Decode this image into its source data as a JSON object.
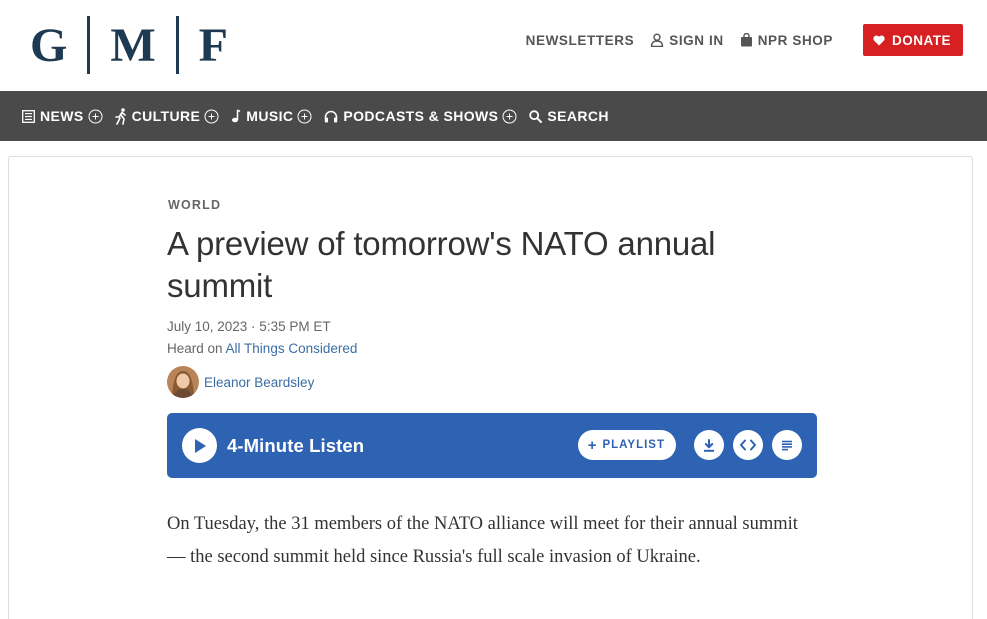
{
  "logo": {
    "letters": [
      "G",
      "M",
      "F"
    ]
  },
  "header": {
    "links": [
      {
        "id": "newsletters",
        "label": "NEWSLETTERS",
        "icon": "none"
      },
      {
        "id": "signin",
        "label": "SIGN IN",
        "icon": "user-icon"
      },
      {
        "id": "shop",
        "label": "NPR SHOP",
        "icon": "bag-icon"
      }
    ],
    "donate_label": "DONATE",
    "donate_color": "#d62021"
  },
  "nav": {
    "items": [
      {
        "label": "NEWS",
        "icon": "news-icon"
      },
      {
        "label": "CULTURE",
        "icon": "culture-icon"
      },
      {
        "label": "MUSIC",
        "icon": "music-note-icon"
      },
      {
        "label": "PODCASTS & SHOWS",
        "icon": "headphones-icon"
      },
      {
        "label": "SEARCH",
        "icon": "search-icon"
      }
    ],
    "background": "#4a4a4a"
  },
  "article": {
    "slug": "WORLD",
    "headline": "A preview of tomorrow's NATO annual summit",
    "date": "July 10, 2023 · 5:35 PM ET",
    "heard_on_prefix": "Heard on ",
    "heard_on_show": "All Things Considered",
    "author": "Eleanor Beardsley",
    "body": "On Tuesday, the 31 members of the NATO alliance will meet for their annual summit — the second summit held since Russia's full scale invasion of Ukraine."
  },
  "player": {
    "listen_label": "4-Minute Listen",
    "playlist_label": "PLAYLIST",
    "background": "#2d63b2",
    "actions": [
      "download-icon",
      "embed-icon",
      "transcript-icon"
    ]
  }
}
